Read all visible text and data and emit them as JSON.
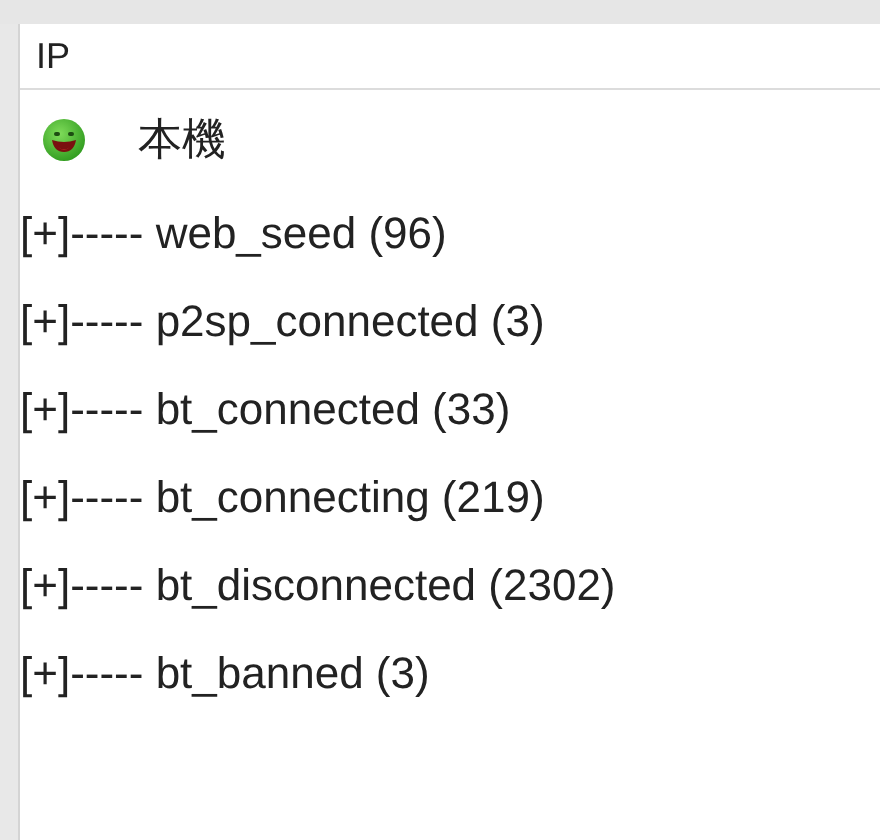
{
  "table": {
    "columns": [
      "IP"
    ]
  },
  "tree": {
    "root": {
      "label": "本機"
    },
    "items": [
      {
        "label": "[+]----- web_seed (96)"
      },
      {
        "label": "[+]----- p2sp_connected (3)"
      },
      {
        "label": "[+]----- bt_connected (33)"
      },
      {
        "label": "[+]----- bt_connecting (219)"
      },
      {
        "label": "[+]----- bt_disconnected (2302)"
      },
      {
        "label": "[+]----- bt_banned (3)"
      }
    ]
  }
}
